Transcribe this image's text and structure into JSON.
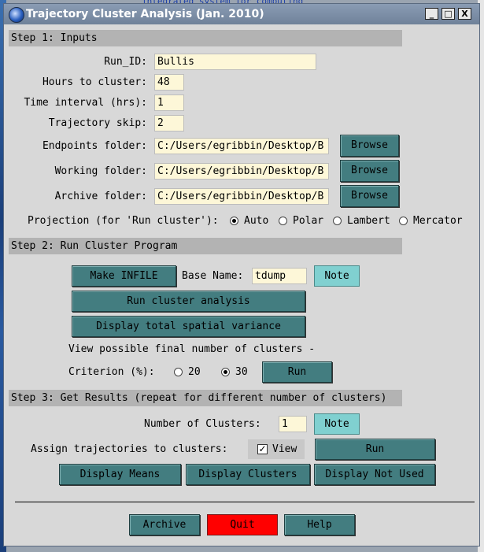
{
  "window": {
    "title": "Trajectory Cluster Analysis (Jan. 2010)",
    "minimize": "_",
    "maximize": "□",
    "close": "X"
  },
  "background": {
    "top_text": "integrated system for computing"
  },
  "step1": {
    "header": "Step 1: Inputs",
    "run_id_label": "Run_ID:",
    "run_id_value": "Bullis",
    "hours_label": "Hours to cluster:",
    "hours_value": "48",
    "interval_label": "Time interval (hrs):",
    "interval_value": "1",
    "skip_label": "Trajectory skip:",
    "skip_value": "2",
    "endpoints_label": "Endpoints folder:",
    "endpoints_value": "C:/Users/egribbin/Desktop/B",
    "working_label": "Working folder:",
    "working_value": "C:/Users/egribbin/Desktop/B",
    "archive_label": "Archive folder:",
    "archive_value": "C:/Users/egribbin/Desktop/B",
    "browse_label": "Browse",
    "projection_label": "Projection (for 'Run cluster'):",
    "projection_options": [
      "Auto",
      "Polar",
      "Lambert",
      "Mercator"
    ],
    "projection_selected": "Auto"
  },
  "step2": {
    "header": "Step 2: Run Cluster Program",
    "make_infile": "Make INFILE",
    "base_name_label": "Base Name:",
    "base_name_value": "tdump",
    "note": "Note",
    "run_cluster": "Run cluster analysis",
    "display_variance": "Display total spatial variance",
    "view_possible": "View possible final number of clusters -",
    "criterion_label": "Criterion (%):",
    "criterion_options": [
      "20",
      "30"
    ],
    "criterion_selected": "30",
    "run": "Run"
  },
  "step3": {
    "header": "Step 3: Get Results (repeat for different number of clusters)",
    "num_clusters_label": "Number of Clusters:",
    "num_clusters_value": "1",
    "note": "Note",
    "assign_label": "Assign trajectories to clusters:",
    "view_label": "View",
    "view_checked": "✓",
    "run": "Run",
    "display_means": "Display Means",
    "display_clusters": "Display Clusters",
    "display_not_used": "Display Not Used"
  },
  "footer": {
    "archive": "Archive",
    "quit": "Quit",
    "help": "Help"
  },
  "colors": {
    "button": "#437d80",
    "note_button": "#80d0d0",
    "quit_button": "#ff0000",
    "field": "#fdf7d8",
    "section": "#b3b3b3"
  }
}
